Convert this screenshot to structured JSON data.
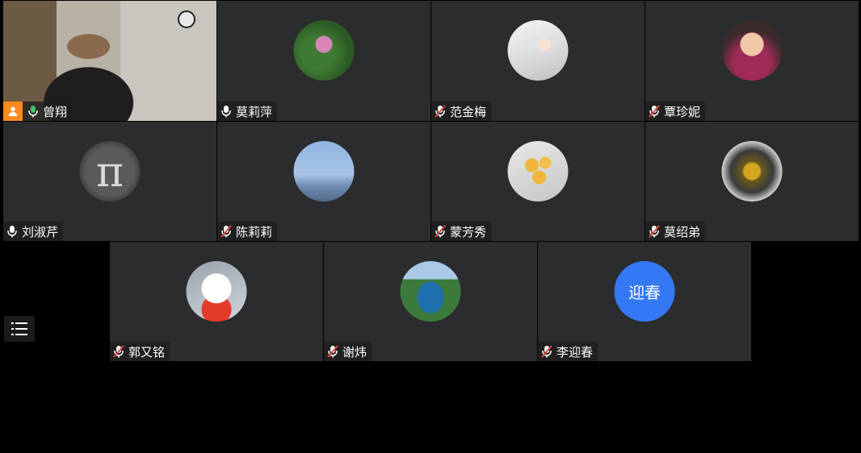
{
  "participants": [
    {
      "name": "曾翔",
      "mic": "on",
      "host": true,
      "avatar": "video-feed",
      "active": true
    },
    {
      "name": "莫莉萍",
      "mic": "on",
      "avatar": "flower-icon"
    },
    {
      "name": "范金梅",
      "mic": "muted",
      "avatar": "bed-photo"
    },
    {
      "name": "覃珍妮",
      "mic": "muted",
      "avatar": "girl-photo"
    },
    {
      "name": "刘淑芹",
      "mic": "on",
      "avatar": "pi-symbol"
    },
    {
      "name": "陈莉莉",
      "mic": "muted",
      "avatar": "sky-photo"
    },
    {
      "name": "蒙芳秀",
      "mic": "muted",
      "avatar": "sunflower-photo"
    },
    {
      "name": "莫绍弟",
      "mic": "muted",
      "avatar": "star-ornament"
    },
    {
      "name": "郭又铭",
      "mic": "muted",
      "avatar": "cat-photo"
    },
    {
      "name": "谢炜",
      "mic": "muted",
      "avatar": "lake-photo"
    },
    {
      "name": "李迎春",
      "mic": "muted",
      "avatar": "text",
      "avatar_text": "迎春"
    }
  ],
  "colors": {
    "tile_bg": "#2b2c2e",
    "active_border": "#3cc36b",
    "host_badge": "#ff8a1f",
    "mic_on": "#3cc36b",
    "mic_muted": "#e2463f",
    "text_avatar": "#3478f6"
  },
  "menu_icon": "list-menu-icon"
}
